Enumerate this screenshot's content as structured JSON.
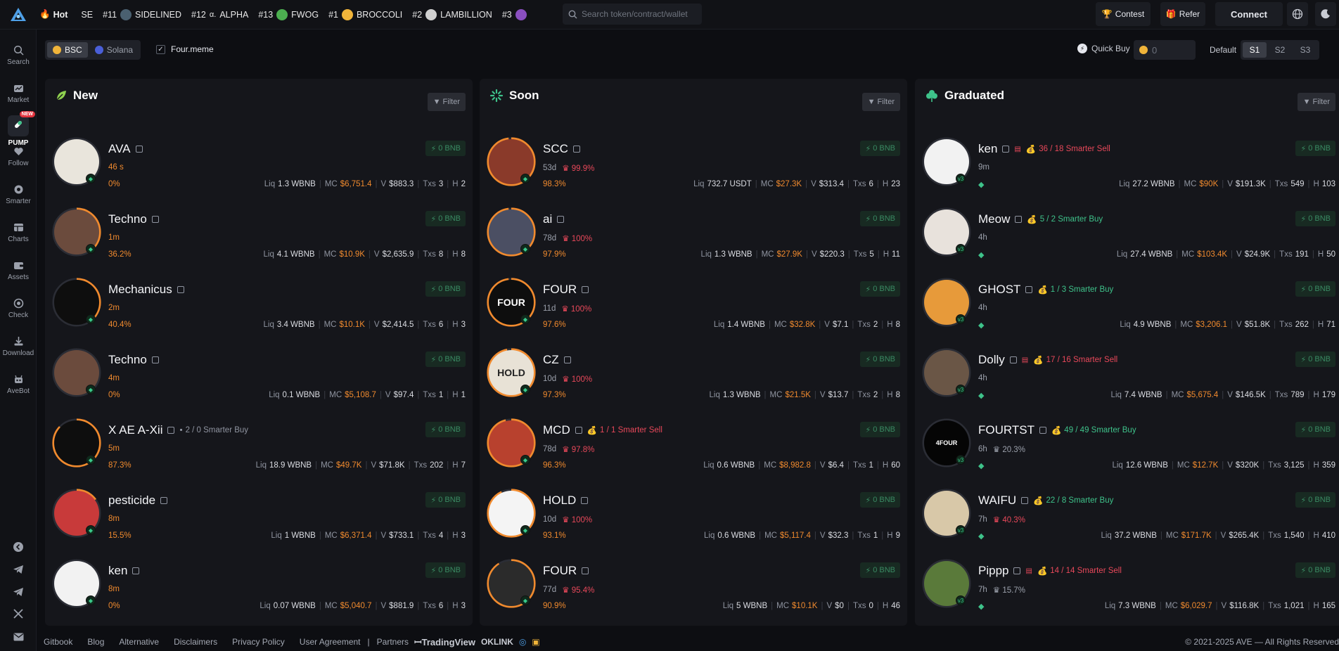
{
  "topbar": {
    "hot_label": "Hot",
    "ticker": [
      {
        "rank": "",
        "name": "SE",
        "color": "#2a2c33"
      },
      {
        "rank": "#11",
        "name": "SIDELINED",
        "color": "#4a6070"
      },
      {
        "rank": "#12",
        "name": "ALPHA",
        "color": "#1b1d23"
      },
      {
        "rank": "#13",
        "name": "FWOG",
        "color": "#4caf50"
      },
      {
        "rank": "#1",
        "name": "BROCCOLI",
        "color": "#f0b43a"
      },
      {
        "rank": "#2",
        "name": "LAMBILLION",
        "color": "#e0e0e0"
      },
      {
        "rank": "#3",
        "name": "",
        "color": "#8a4fc0"
      }
    ],
    "search_placeholder": "Search token/contract/wallet",
    "contest_label": "Contest",
    "refer_label": "Refer",
    "connect_label": "Connect"
  },
  "sidebar": {
    "items": [
      "Search",
      "Market",
      "PUMP",
      "Follow",
      "Smarter",
      "Charts",
      "Assets",
      "Check",
      "Download",
      "AveBot"
    ],
    "new_badge": "NEW"
  },
  "filters": {
    "chains": [
      "BSC",
      "Solana"
    ],
    "active_chain": "BSC",
    "platform_label": "Four.meme",
    "quick_buy_label": "Quick Buy",
    "quick_buy_value": "0",
    "default_label": "Default",
    "presets": [
      "S1",
      "S2",
      "S3"
    ]
  },
  "colors": {
    "accent_orange": "#f08a2e",
    "buy_green": "#3ec28a",
    "sell_red": "#e8485a"
  },
  "columns": [
    {
      "title": "New",
      "filter_label": "Filter",
      "tokens": [
        {
          "name": "AVA",
          "signal": "",
          "age": "46 s",
          "pct": "",
          "progress": "0%",
          "liq": "1.3 WBNB",
          "mc": "$6,751.4",
          "vol": "$883.3",
          "txs": "3",
          "h": "2",
          "buy": "0 BNB",
          "avatar_color": "#e9e5dc",
          "avatar_text": "",
          "ring": 0.0
        },
        {
          "name": "Techno",
          "signal": "",
          "age": "1m",
          "pct": "",
          "progress": "36.2%",
          "liq": "4.1 WBNB",
          "mc": "$10.9K",
          "vol": "$2,635.9",
          "txs": "8",
          "h": "8",
          "buy": "0 BNB",
          "avatar_color": "#6b4b3d",
          "avatar_text": "",
          "ring": 0.36
        },
        {
          "name": "Mechanicus",
          "signal": "",
          "age": "2m",
          "pct": "",
          "progress": "40.4%",
          "liq": "3.4 WBNB",
          "mc": "$10.1K",
          "vol": "$2,414.5",
          "txs": "6",
          "h": "3",
          "buy": "0 BNB",
          "avatar_color": "#0e0e0e",
          "avatar_text": "",
          "ring": 0.4
        },
        {
          "name": "Techno",
          "signal": "",
          "age": "4m",
          "pct": "",
          "progress": "0%",
          "liq": "0.1 WBNB",
          "mc": "$5,108.7",
          "vol": "$97.4",
          "txs": "1",
          "h": "1",
          "buy": "0 BNB",
          "avatar_color": "#6b4b3d",
          "avatar_text": "",
          "ring": 0.0
        },
        {
          "name": "X AE A-Xii",
          "signal": "2 / 0 Smarter Buy",
          "signal_type": "grey",
          "age": "5m",
          "pct": "",
          "progress": "87.3%",
          "liq": "18.9 WBNB",
          "mc": "$49.7K",
          "vol": "$71.8K",
          "txs": "202",
          "h": "7",
          "buy": "0 BNB",
          "avatar_color": "#0e0e0e",
          "avatar_text": "",
          "ring": 0.87
        },
        {
          "name": "pesticide",
          "signal": "",
          "age": "8m",
          "pct": "",
          "progress": "15.5%",
          "liq": "1 WBNB",
          "mc": "$6,371.4",
          "vol": "$733.1",
          "txs": "4",
          "h": "3",
          "buy": "0 BNB",
          "avatar_color": "#c83a3a",
          "avatar_text": "",
          "ring": 0.15
        },
        {
          "name": "ken",
          "signal": "",
          "age": "8m",
          "pct": "",
          "progress": "0%",
          "liq": "0.07 WBNB",
          "mc": "$5,040.7",
          "vol": "$881.9",
          "txs": "6",
          "h": "3",
          "buy": "0 BNB",
          "avatar_color": "#f2f2f2",
          "avatar_text": "",
          "ring": 0.0
        }
      ]
    },
    {
      "title": "Soon",
      "filter_label": "Filter",
      "tokens": [
        {
          "name": "SCC",
          "signal": "",
          "age": "53d",
          "pct": "99.9%",
          "progress": "98.3%",
          "liq": "732.7 USDT",
          "mc": "$27.3K",
          "vol": "$313.4",
          "txs": "6",
          "h": "23",
          "buy": "0 BNB",
          "avatar_color": "#8a3a2a",
          "avatar_text": "",
          "ring": 0.98
        },
        {
          "name": "ai",
          "signal": "",
          "age": "78d",
          "pct": "100%",
          "progress": "97.9%",
          "liq": "1.3 WBNB",
          "mc": "$27.9K",
          "vol": "$220.3",
          "txs": "5",
          "h": "11",
          "buy": "0 BNB",
          "avatar_color": "#4b4f63",
          "avatar_text": "",
          "ring": 0.98
        },
        {
          "name": "FOUR",
          "signal": "",
          "age": "11d",
          "pct": "100%",
          "progress": "97.6%",
          "liq": "1.4 WBNB",
          "mc": "$32.8K",
          "vol": "$7.1",
          "txs": "2",
          "h": "8",
          "buy": "0 BNB",
          "avatar_color": "#0e0e0e",
          "avatar_text": "FOUR",
          "ring": 0.98
        },
        {
          "name": "CZ",
          "signal": "",
          "age": "10d",
          "pct": "100%",
          "progress": "97.3%",
          "liq": "1.3 WBNB",
          "mc": "$21.5K",
          "vol": "$13.7",
          "txs": "2",
          "h": "8",
          "buy": "0 BNB",
          "avatar_color": "#e8e2d6",
          "avatar_text": "HOLD",
          "ring": 0.97
        },
        {
          "name": "MCD",
          "signal": "1 / 1 Smarter Sell",
          "signal_type": "down",
          "age": "78d",
          "pct": "97.8%",
          "progress": "96.3%",
          "liq": "0.6 WBNB",
          "mc": "$8,982.8",
          "vol": "$6.4",
          "txs": "1",
          "h": "60",
          "buy": "0 BNB",
          "avatar_color": "#b8412e",
          "avatar_text": "",
          "ring": 0.96
        },
        {
          "name": "HOLD",
          "signal": "",
          "age": "10d",
          "pct": "100%",
          "progress": "93.1%",
          "liq": "0.6 WBNB",
          "mc": "$5,117.4",
          "vol": "$32.3",
          "txs": "1",
          "h": "9",
          "buy": "0 BNB",
          "avatar_color": "#f4f4f4",
          "avatar_text": "",
          "ring": 0.93
        },
        {
          "name": "FOUR",
          "signal": "",
          "age": "77d",
          "pct": "95.4%",
          "progress": "90.9%",
          "liq": "5 WBNB",
          "mc": "$10.1K",
          "vol": "$0",
          "txs": "0",
          "h": "46",
          "buy": "0 BNB",
          "avatar_color": "#2b2b2b",
          "avatar_text": "",
          "ring": 0.91
        }
      ]
    },
    {
      "title": "Graduated",
      "filter_label": "Filter",
      "tokens": [
        {
          "name": "ken",
          "signal": "36 / 18 Smarter Sell",
          "signal_type": "down",
          "age": "9m",
          "pct": "",
          "progress": "",
          "liq": "27.2 WBNB",
          "mc": "$90K",
          "vol": "$191.3K",
          "txs": "549",
          "h": "103",
          "buy": "0 BNB",
          "avatar_color": "#f2f2f2",
          "avatar_text": "",
          "ring": 0
        },
        {
          "name": "Meow",
          "signal": "5 / 2 Smarter Buy",
          "signal_type": "up",
          "age": "4h",
          "pct": "",
          "progress": "",
          "liq": "27.4 WBNB",
          "mc": "$103.4K",
          "vol": "$24.9K",
          "txs": "191",
          "h": "50",
          "buy": "0 BNB",
          "avatar_color": "#e8e2dc",
          "avatar_text": "",
          "ring": 0
        },
        {
          "name": "GHOST",
          "signal": "1 / 3 Smarter Buy",
          "signal_type": "up",
          "age": "4h",
          "pct": "",
          "progress": "",
          "liq": "4.9 WBNB",
          "mc": "$3,206.1",
          "vol": "$51.8K",
          "txs": "262",
          "h": "71",
          "buy": "0 BNB",
          "avatar_color": "#e79a3a",
          "avatar_text": "",
          "ring": 0
        },
        {
          "name": "Dolly",
          "signal": "17 / 16 Smarter Sell",
          "signal_type": "down",
          "age": "4h",
          "pct": "",
          "progress": "",
          "liq": "7.4 WBNB",
          "mc": "$5,675.4",
          "vol": "$146.5K",
          "txs": "789",
          "h": "179",
          "buy": "0 BNB",
          "avatar_color": "#6a5646",
          "avatar_text": "",
          "ring": 0
        },
        {
          "name": "FOURTST",
          "signal": "49 / 49 Smarter Buy",
          "signal_type": "up",
          "age": "6h",
          "pct": "20.3%",
          "pct_type": "grey",
          "progress": "",
          "liq": "12.6 WBNB",
          "mc": "$12.7K",
          "vol": "$320K",
          "txs": "3,125",
          "h": "359",
          "buy": "0 BNB",
          "avatar_color": "#050505",
          "avatar_text": "4FOUR",
          "ring": 0
        },
        {
          "name": "WAIFU",
          "signal": "22 / 8 Smarter Buy",
          "signal_type": "up",
          "age": "7h",
          "pct": "40.3%",
          "pct_type": "red",
          "progress": "",
          "liq": "37.2 WBNB",
          "mc": "$171.7K",
          "vol": "$265.4K",
          "txs": "1,540",
          "h": "410",
          "buy": "0 BNB",
          "avatar_color": "#d8c8a8",
          "avatar_text": "",
          "ring": 0
        },
        {
          "name": "Pippp",
          "signal": "14 / 14 Smarter Sell",
          "signal_type": "down",
          "age": "7h",
          "pct": "15.7%",
          "pct_type": "grey",
          "progress": "",
          "liq": "7.3 WBNB",
          "mc": "$6,029.7",
          "vol": "$116.8K",
          "txs": "1,021",
          "h": "165",
          "buy": "0 BNB",
          "avatar_color": "#5a7a3a",
          "avatar_text": "",
          "ring": 0
        }
      ]
    }
  ],
  "stat_labels": {
    "liq": "Liq",
    "mc": "MC",
    "vol": "V",
    "txs": "Txs",
    "h": "H"
  },
  "footer": {
    "links": [
      "Gitbook",
      "Blog",
      "Alternative",
      "Disclaimers",
      "Privacy Policy",
      "User Agreement"
    ],
    "partners_label": "Partners",
    "tradingview": "TradingView",
    "oklink": "OKLINK",
    "copyright": "© 2021-2025 AVE — All Rights Reserved"
  }
}
